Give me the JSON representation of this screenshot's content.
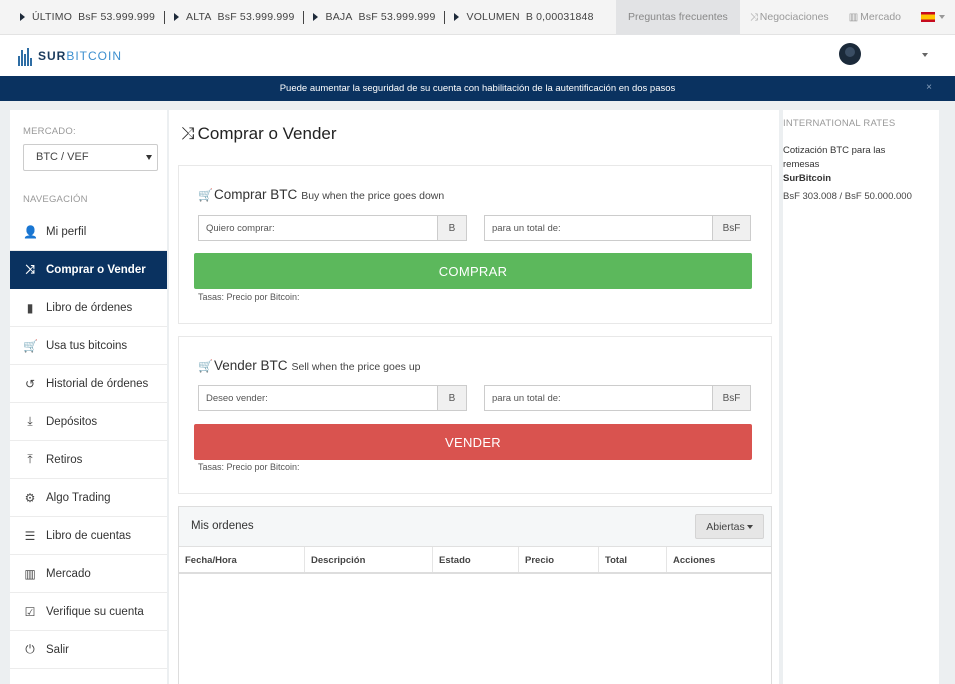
{
  "ticker": [
    {
      "label": "ÚLTIMO",
      "value": "BsF 53.999.999"
    },
    {
      "label": "ALTA",
      "value": "BsF 53.999.999"
    },
    {
      "label": "BAJA",
      "value": "BsF 53.999.999"
    },
    {
      "label": "VOLUMEN",
      "value": "B 0,00031848"
    }
  ],
  "top_nav": {
    "faq": "Preguntas frecuentes",
    "trades": "Negociaciones",
    "market": "Mercado"
  },
  "brand": {
    "part1": "SUR",
    "part2": "BITCOIN"
  },
  "banner": {
    "text": "Puede aumentar la seguridad de su cuenta con habilitación de la autentificación en dos pasos",
    "close": "×"
  },
  "sidebar": {
    "market_label": "MERCADO:",
    "market_value": "BTC / VEF",
    "nav_label": "NAVEGACIÓN",
    "items": [
      {
        "label": "Mi perfil",
        "icon": "user-icon"
      },
      {
        "label": "Comprar o Vender",
        "icon": "shuffle-icon"
      },
      {
        "label": "Libro de órdenes",
        "icon": "book-icon"
      },
      {
        "label": "Usa tus bitcoins",
        "icon": "cart-icon"
      },
      {
        "label": "Historial de órdenes",
        "icon": "history-icon"
      },
      {
        "label": "Depósitos",
        "icon": "download-icon"
      },
      {
        "label": "Retiros",
        "icon": "upload-icon"
      },
      {
        "label": "Algo Trading",
        "icon": "gear-icon"
      },
      {
        "label": "Libro de cuentas",
        "icon": "list-icon"
      },
      {
        "label": "Mercado",
        "icon": "bar-chart-icon"
      },
      {
        "label": "Verifique su cuenta",
        "icon": "check-square-icon"
      },
      {
        "label": "Salir",
        "icon": "power-icon"
      }
    ]
  },
  "main": {
    "title": "Comprar o Vender",
    "buy": {
      "title": "Comprar BTC",
      "subtitle": "Buy when the price goes down",
      "amount_placeholder": "Quiero comprar:",
      "amount_unit": "B",
      "total_placeholder": "para un total de:",
      "total_unit": "BsF",
      "button": "COMPRAR",
      "rates": "Tasas: Precio por Bitcoin:"
    },
    "sell": {
      "title": "Vender BTC",
      "subtitle": "Sell when the price goes up",
      "amount_placeholder": "Deseo vender:",
      "amount_unit": "B",
      "total_placeholder": "para un total de:",
      "total_unit": "BsF",
      "button": "VENDER",
      "rates": "Tasas: Precio por Bitcoin:"
    },
    "orders": {
      "title": "Mis ordenes",
      "filter": "Abiertas",
      "columns": [
        "Fecha/Hora",
        "Descripción",
        "Estado",
        "Precio",
        "Total",
        "Acciones"
      ]
    }
  },
  "right": {
    "title": "INTERNATIONAL RATES",
    "line1": "Cotización BTC para las",
    "line2": "remesas",
    "line3": "SurBitcoin",
    "line4": "BsF 303.008 / BsF 50.000.000"
  },
  "colors": {
    "navy": "#0a3260",
    "buy": "#5cb85c",
    "sell": "#d9534f"
  }
}
